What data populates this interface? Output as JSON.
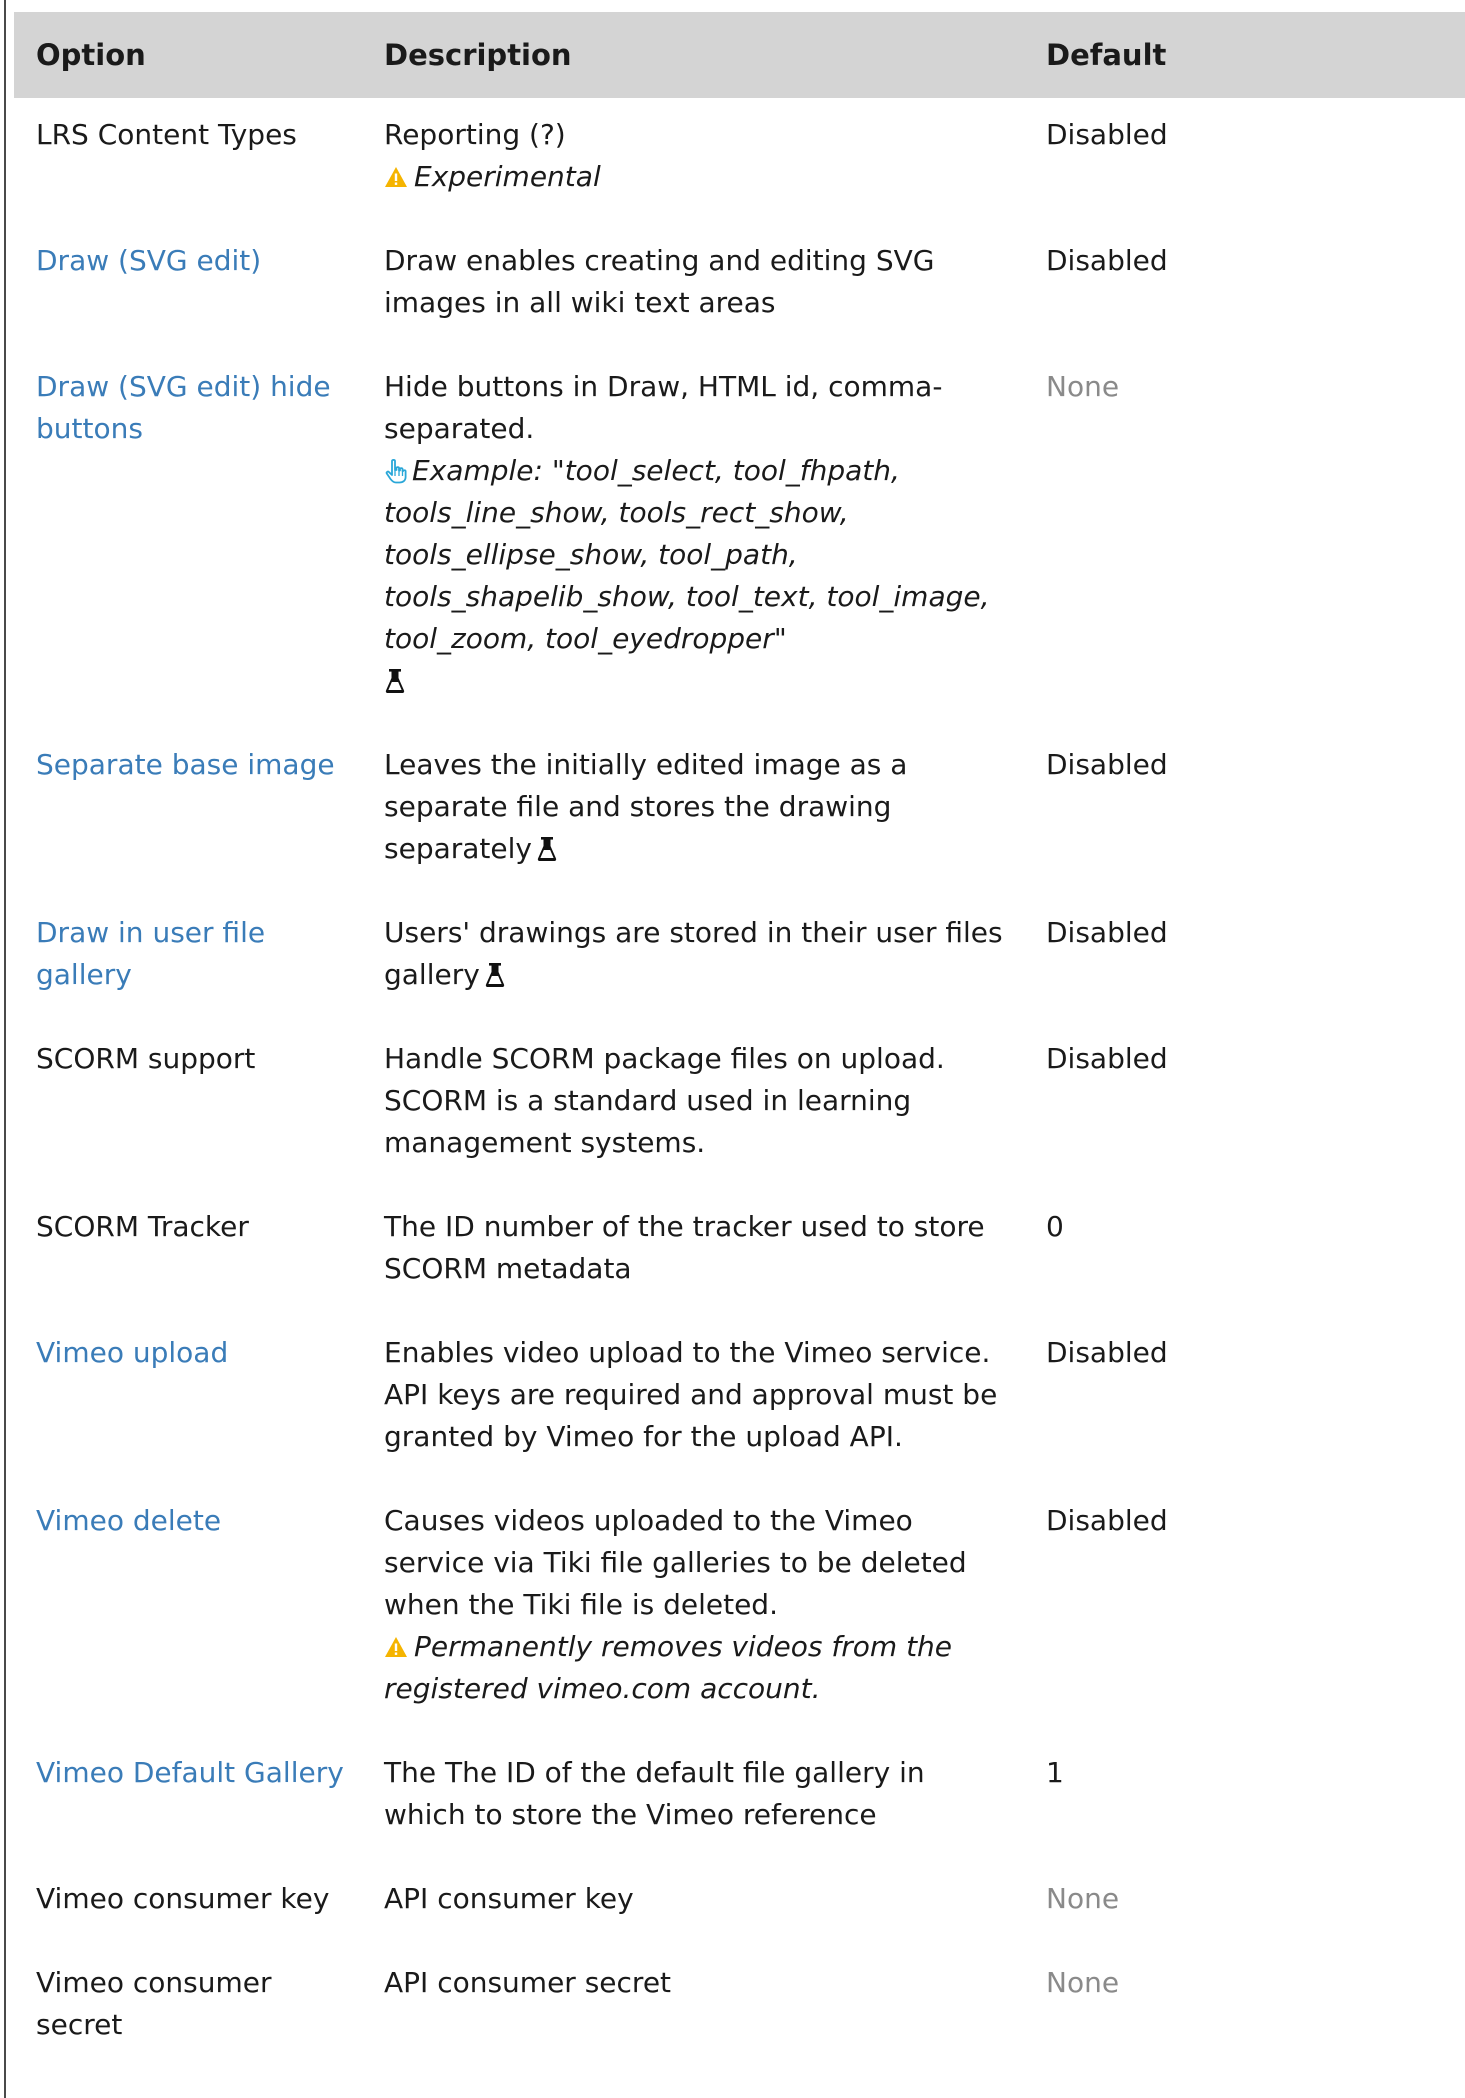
{
  "table": {
    "headers": {
      "option": "Option",
      "description": "Description",
      "default": "Default"
    },
    "rows": [
      {
        "option": "LRS Content Types",
        "description": "Reporting (?)",
        "note": "Experimental",
        "default": "Disabled"
      },
      {
        "option": "Draw (SVG edit)",
        "description": "Draw enables creating and editing SVG images in all wiki text areas",
        "default": "Disabled"
      },
      {
        "option": "Draw (SVG edit) hide buttons",
        "description": "Hide buttons in Draw, HTML id, comma-separated.",
        "example_label": "Example:",
        "example_value": "tool_select, tool_fhpath, tools_line_show, tools_rect_show, tools_ellipse_show, tool_path, tools_shapelib_show, tool_text, tool_image, tool_zoom, tool_eyedropper",
        "default": "None"
      },
      {
        "option": "Separate base image",
        "description": "Leaves the initially edited image as a separate file and stores the drawing separately",
        "default": "Disabled"
      },
      {
        "option": "Draw in user file gallery",
        "description": "Users' drawings are stored in their user files gallery",
        "default": "Disabled"
      },
      {
        "option": "SCORM support",
        "description": "Handle SCORM package files on upload. SCORM is a standard used in learning management systems.",
        "default": "Disabled"
      },
      {
        "option": "SCORM Tracker",
        "description": "The ID number of the tracker used to store SCORM metadata",
        "default": "0"
      },
      {
        "option": "Vimeo upload",
        "description": "Enables video upload to the Vimeo service. API keys are required and approval must be granted by Vimeo for the upload API.",
        "default": "Disabled"
      },
      {
        "option": "Vimeo delete",
        "description": "Causes videos uploaded to the Vimeo service via Tiki file galleries to be deleted when the Tiki file is deleted.",
        "note": "Permanently removes videos from the registered vimeo.com account.",
        "default": "Disabled"
      },
      {
        "option": "Vimeo Default Gallery",
        "description": "The The ID of the default file gallery in which to store the Vimeo reference",
        "default": "1"
      },
      {
        "option": "Vimeo consumer key",
        "description": "API consumer key",
        "default": "None"
      },
      {
        "option": "Vimeo consumer secret",
        "description": "API consumer secret",
        "default": "None"
      }
    ]
  },
  "colors": {
    "link": "#3a7cb8",
    "header_bg": "#d4d4d4",
    "muted": "#8a8a8a",
    "warning": "#f5b400",
    "hand": "#2aa7d8"
  },
  "icons": {
    "warning": "warning-icon",
    "hand": "hand-pointer-icon",
    "experimental": "flask-icon"
  }
}
